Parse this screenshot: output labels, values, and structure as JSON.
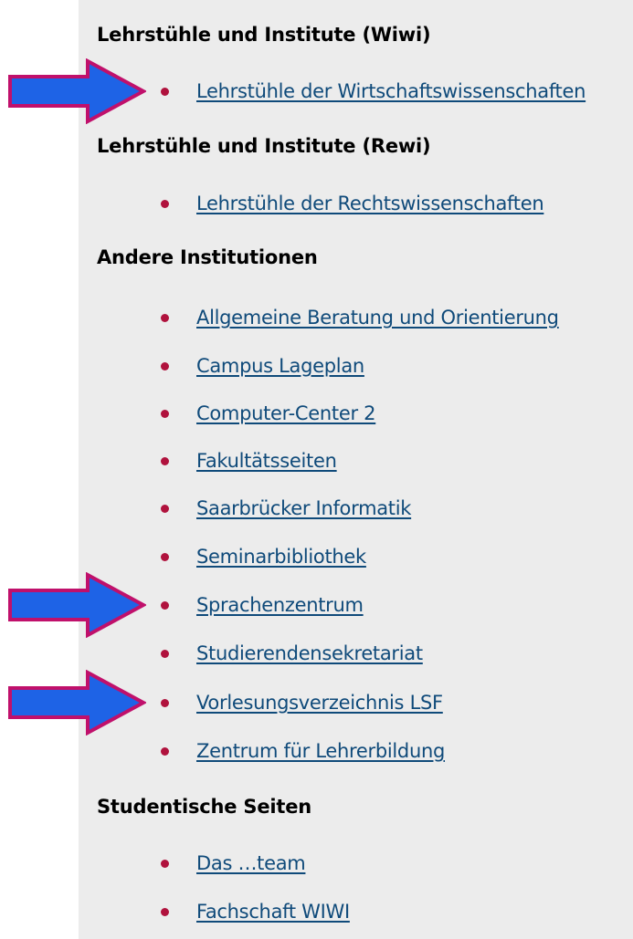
{
  "sections": [
    {
      "heading": "Lehrstühle und Institute (Wiwi)",
      "links": [
        "Lehrstühle der Wirtschaftswissenschaften"
      ]
    },
    {
      "heading": "Lehrstühle und Institute (Rewi)",
      "links": [
        "Lehrstühle der Rechtswissenschaften"
      ]
    },
    {
      "heading": "Andere Institutionen",
      "links": [
        "Allgemeine Beratung und Orientierung",
        "Campus Lageplan",
        "Computer-Center 2",
        "Fakultätsseiten",
        "Saarbrücker Informatik",
        "Seminarbibliothek",
        "Sprachenzentrum",
        "Studierendensekretariat",
        "Vorlesungsverzeichnis LSF",
        "Zentrum für Lehrerbildung"
      ]
    },
    {
      "heading": "Studentische Seiten",
      "links": [
        "Das …team",
        "Fachschaft WIWI"
      ]
    }
  ],
  "colors": {
    "panel_background": "#ececec",
    "heading_text": "#000000",
    "link_text": "#0f4a7a",
    "bullet": "#b0123d",
    "arrow_fill": "#1e63e6",
    "arrow_outline": "#c0106b"
  },
  "highlight_arrows": {
    "icon": "arrow-right-icon",
    "marked_links": [
      "Lehrstühle der Wirtschaftswissenschaften",
      "Sprachenzentrum",
      "Vorlesungsverzeichnis LSF"
    ]
  }
}
